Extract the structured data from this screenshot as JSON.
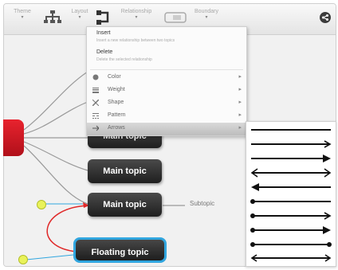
{
  "toolbar": {
    "items": [
      {
        "name": "tb-theme",
        "label": "Theme"
      },
      {
        "name": "tb-layout",
        "label": "Layout"
      },
      {
        "name": "tb-relationship",
        "label": "Relationship"
      },
      {
        "name": "tb-boundary",
        "label": "Boundary"
      }
    ]
  },
  "context_menu": {
    "insert": {
      "title": "Insert",
      "description": "Insert a new relationship between two topics"
    },
    "delete": {
      "title": "Delete",
      "description": "Delete the selected relationship"
    },
    "rows": [
      {
        "label": "Color",
        "icon": "color-icon"
      },
      {
        "label": "Weight",
        "icon": "weight-icon"
      },
      {
        "label": "Shape",
        "icon": "shape-icon"
      },
      {
        "label": "Pattern",
        "icon": "pattern-icon"
      },
      {
        "label": "Arrows",
        "icon": "arrows-icon",
        "active": true
      }
    ]
  },
  "canvas": {
    "topics": [
      {
        "label": "Main topic"
      },
      {
        "label": "Main topic"
      },
      {
        "label": "Main topic"
      }
    ],
    "floating_topic": "Floating topic",
    "subtopic": "Subtopic"
  },
  "arrow_styles": [
    "none",
    "right-arrow",
    "right-arrow-large",
    "both-arrows",
    "left-arrow",
    "dot-left",
    "dot-right-arrow",
    "dot-both",
    "dot-dot",
    "arrow-both-narrow"
  ],
  "colors": {
    "accent_blue": "#31a6df",
    "root_red": "#d8222b",
    "relationship_red": "#e02a2a",
    "handle_yellow": "#e9f25a"
  }
}
